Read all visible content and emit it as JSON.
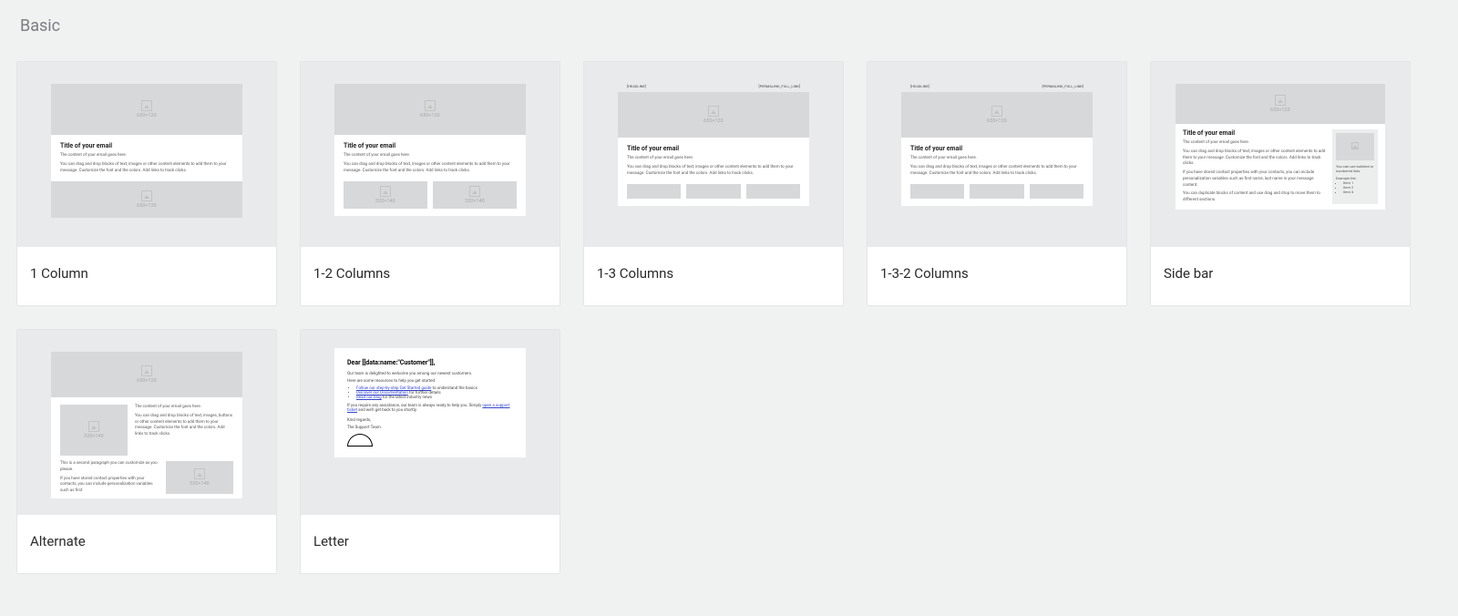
{
  "section_title": "Basic",
  "templates": [
    {
      "label": "1 Column"
    },
    {
      "label": "1-2 Columns"
    },
    {
      "label": "1-3 Columns"
    },
    {
      "label": "1-3-2 Columns"
    },
    {
      "label": "Side bar"
    },
    {
      "label": "Alternate"
    },
    {
      "label": "Letter"
    }
  ],
  "preview_common": {
    "title": "Title of your email",
    "content_intro": "The content of your email goes here.",
    "drag_drop_long": "You can drag and drop blocks of text, images or other content elements to add them to your message. Customize the font and the colors. Add links to track clicks.",
    "drag_drop_med": "You can drag and drop blocks of text, images or other content elements to add them to your message. Customize the font and the colors. Add links to track clicks.",
    "headline_tag": "[HEADLINE]",
    "permalink_tag": "[PERMALINK_FULL_LINK]",
    "image_placeholder": "650×120"
  },
  "sidebar_preview": {
    "p1": "You can drag and drop blocks of text, images or other content elements to add them to your message. Customize the font and the colors. Add links to track clicks.",
    "p2": "If you have stored contact properties with your contacts, you can include personalization variables such as first name, last name in your message content.",
    "p3": "You can duplicate blocks of content and use drag and drop to move them to different sections.",
    "side_text": "You can use bulleted or numbered lists.",
    "example_label": "Example list:",
    "items": [
      "Item 1",
      "Item 2",
      "Item 3"
    ]
  },
  "alternate_preview": {
    "p1": "The content of your email goes here.",
    "p2": "You can drag and drop blocks of text, images, buttons or other content elements to add them to your message. Customize the font and the colors. Add links to track clicks.",
    "p3": "This is a second paragraph you can customize as you please.",
    "p4": "If you have stored contact properties with your contacts, you can include personalization variables such as first"
  },
  "letter_preview": {
    "greeting": "Dear [[data:name:\"Customer\"]],",
    "l1": "Our team is delighted to welcome you among our newest customers.",
    "l2": "Here are some resources to help you get started:",
    "b1a": "Follow our step-by-step Get Started guide",
    "b1b": " to understand the basics",
    "b2a": "Discover our Documentation",
    "b2b": " for further details",
    "b3a": "Read our blog",
    "b3b": " for the latest industry news",
    "l3a": "If you require any assistance, our team is always ready to help you. Simply ",
    "l3b": "open a support ticket",
    "l3c": " and we'll get back to you shortly.",
    "l4": "Kind regards,",
    "l5": "The Support Team."
  }
}
